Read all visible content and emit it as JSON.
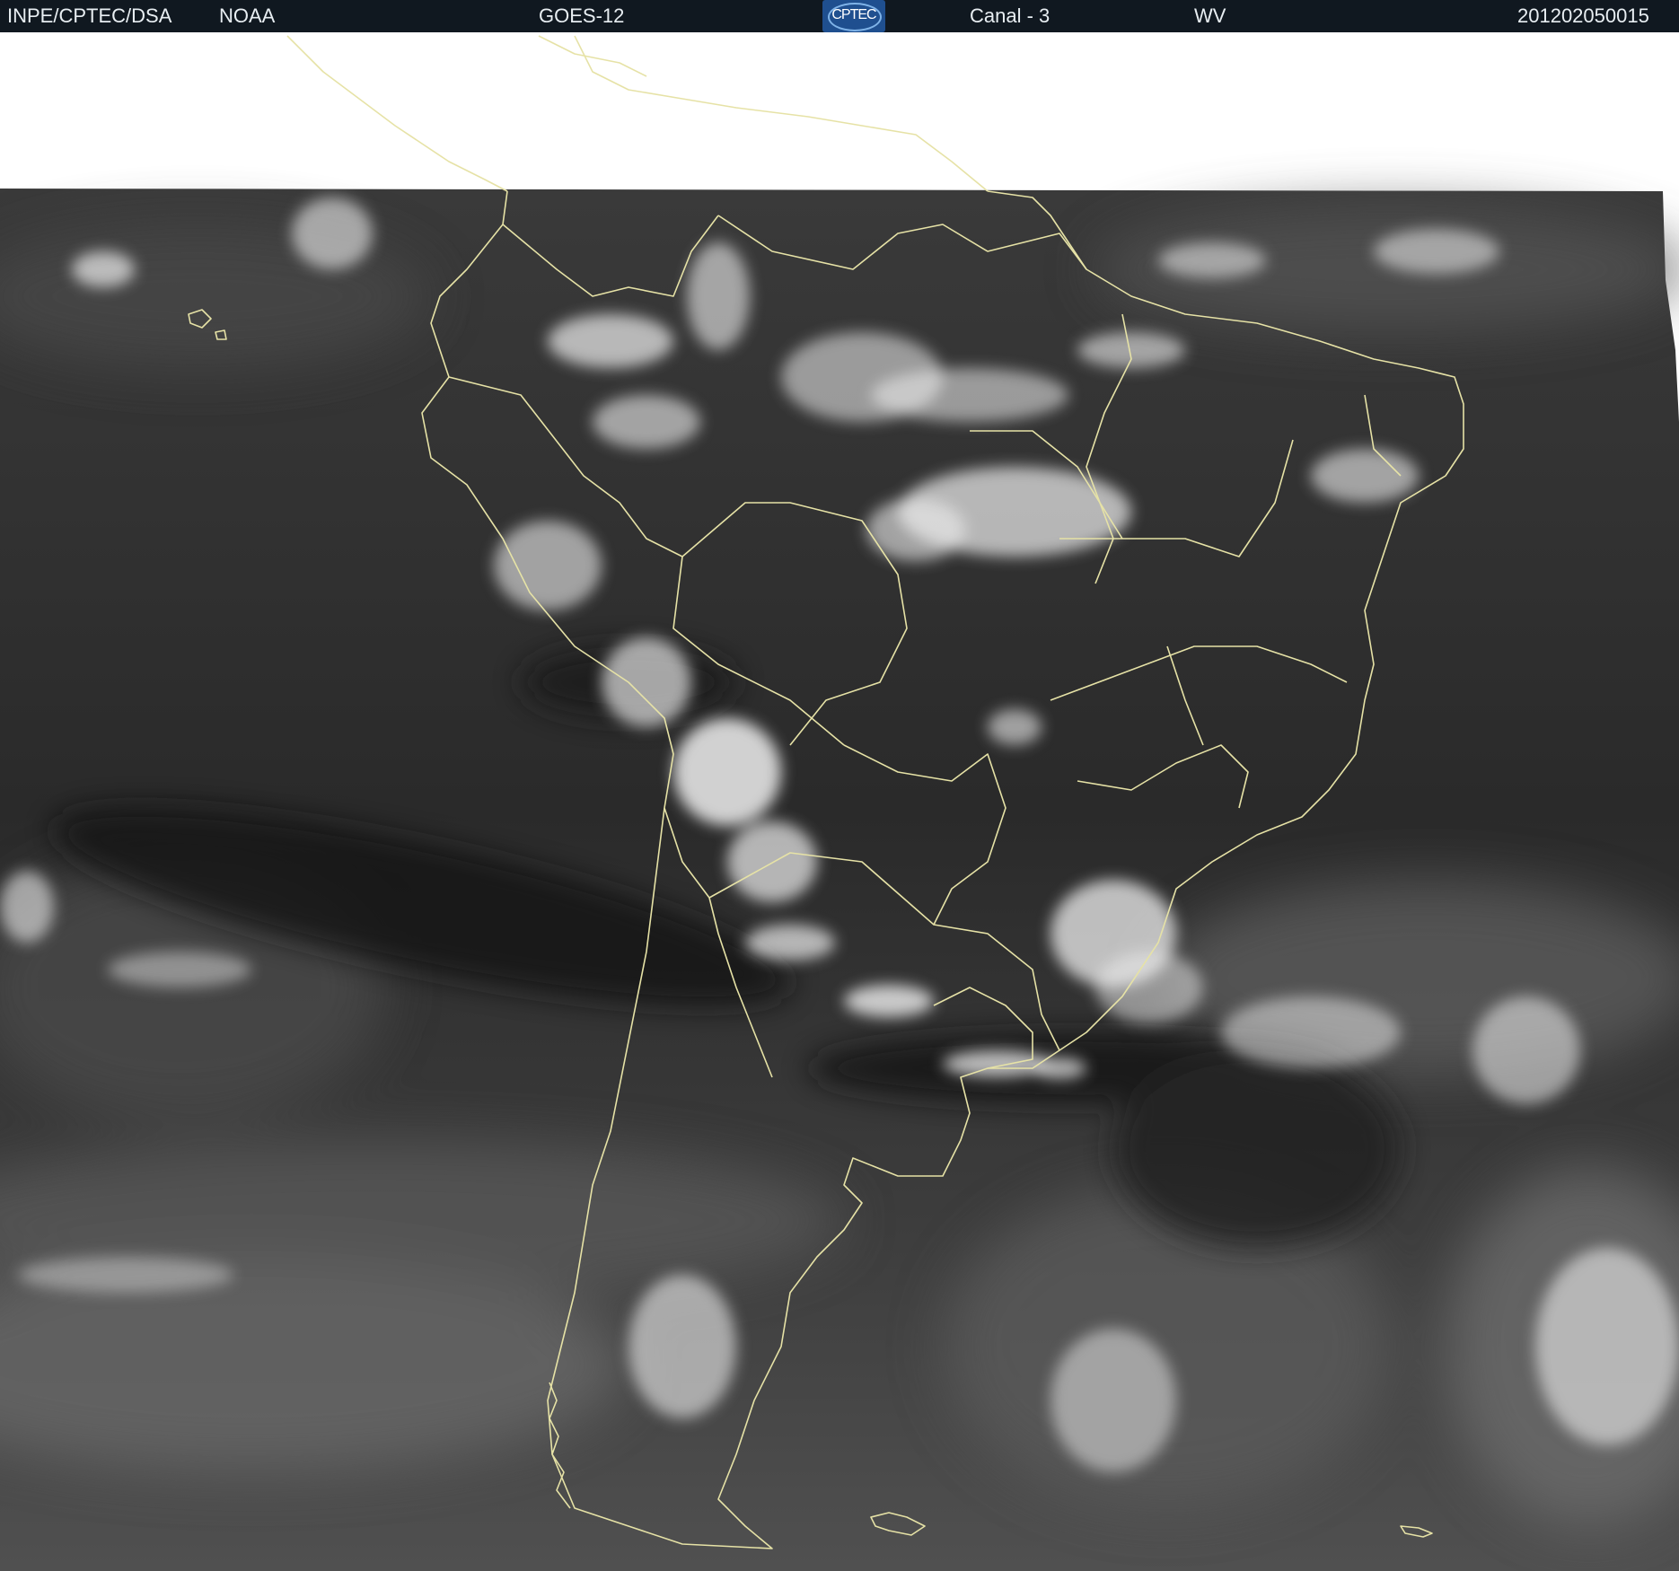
{
  "header": {
    "org": "INPE/CPTEC/DSA",
    "agency": "NOAA",
    "satellite": "GOES-12",
    "logo_text": "CPTEC",
    "channel": "Canal - 3",
    "band": "WV",
    "timestamp": "201202050015"
  },
  "colors": {
    "header_bg": "#101820",
    "coastline": "#e6e2a6",
    "sky_dark": "#2b2b2b",
    "cloud_bright": "#f2f2f2"
  }
}
